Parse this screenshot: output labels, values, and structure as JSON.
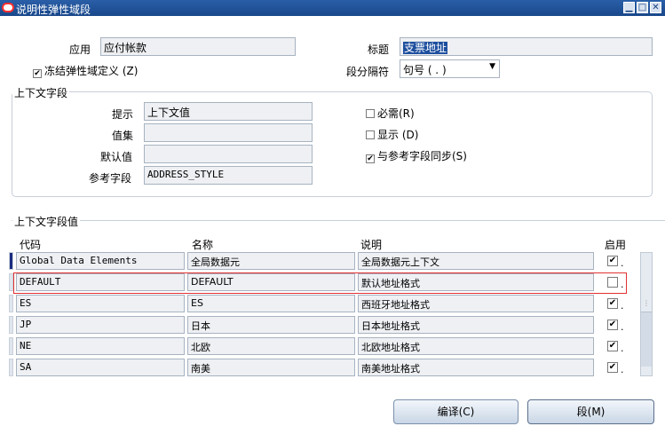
{
  "window": {
    "title": "说明性弹性域段"
  },
  "top": {
    "app_label": "应用",
    "app_value": "应付帐款",
    "title_label": "标题",
    "title_value": "支票地址",
    "freeze_label": "冻结弹性域定义 (Z)",
    "separator_label": "段分隔符",
    "separator_value": "句号 ( . )"
  },
  "context": {
    "section_title": "上下文字段",
    "prompt_label": "提示",
    "prompt_value": "上下文值",
    "valueset_label": "值集",
    "valueset_value": "",
    "default_label": "默认值",
    "default_value": "",
    "reference_label": "参考字段",
    "reference_value": "ADDRESS_STYLE",
    "required_label": "必需(R)",
    "display_label": "显示 (D)",
    "sync_label": "与参考字段同步(S)"
  },
  "values": {
    "section_title": "上下文字段值",
    "headers": {
      "code": "代码",
      "name": "名称",
      "desc": "说明",
      "enabled": "启用"
    },
    "rows": [
      {
        "code": "Global Data Elements",
        "name": "全局数据元",
        "desc": "全局数据元上下文",
        "enabled": "✔"
      },
      {
        "code": "DEFAULT",
        "name": "DEFAULT",
        "desc": "默认地址格式",
        "enabled": ""
      },
      {
        "code": "ES",
        "name": "ES",
        "desc": "西班牙地址格式",
        "enabled": "✔"
      },
      {
        "code": "JP",
        "name": "日本",
        "desc": "日本地址格式",
        "enabled": "✔"
      },
      {
        "code": "NE",
        "name": "北欧",
        "desc": "北欧地址格式",
        "enabled": "✔"
      },
      {
        "code": "SA",
        "name": "南美",
        "desc": "南美地址格式",
        "enabled": "✔"
      }
    ]
  },
  "buttons": {
    "compile": "编译(C)",
    "segments": "段(M)"
  },
  "colors": {
    "highlight": "#e03030",
    "titlebar": "#19478a"
  }
}
